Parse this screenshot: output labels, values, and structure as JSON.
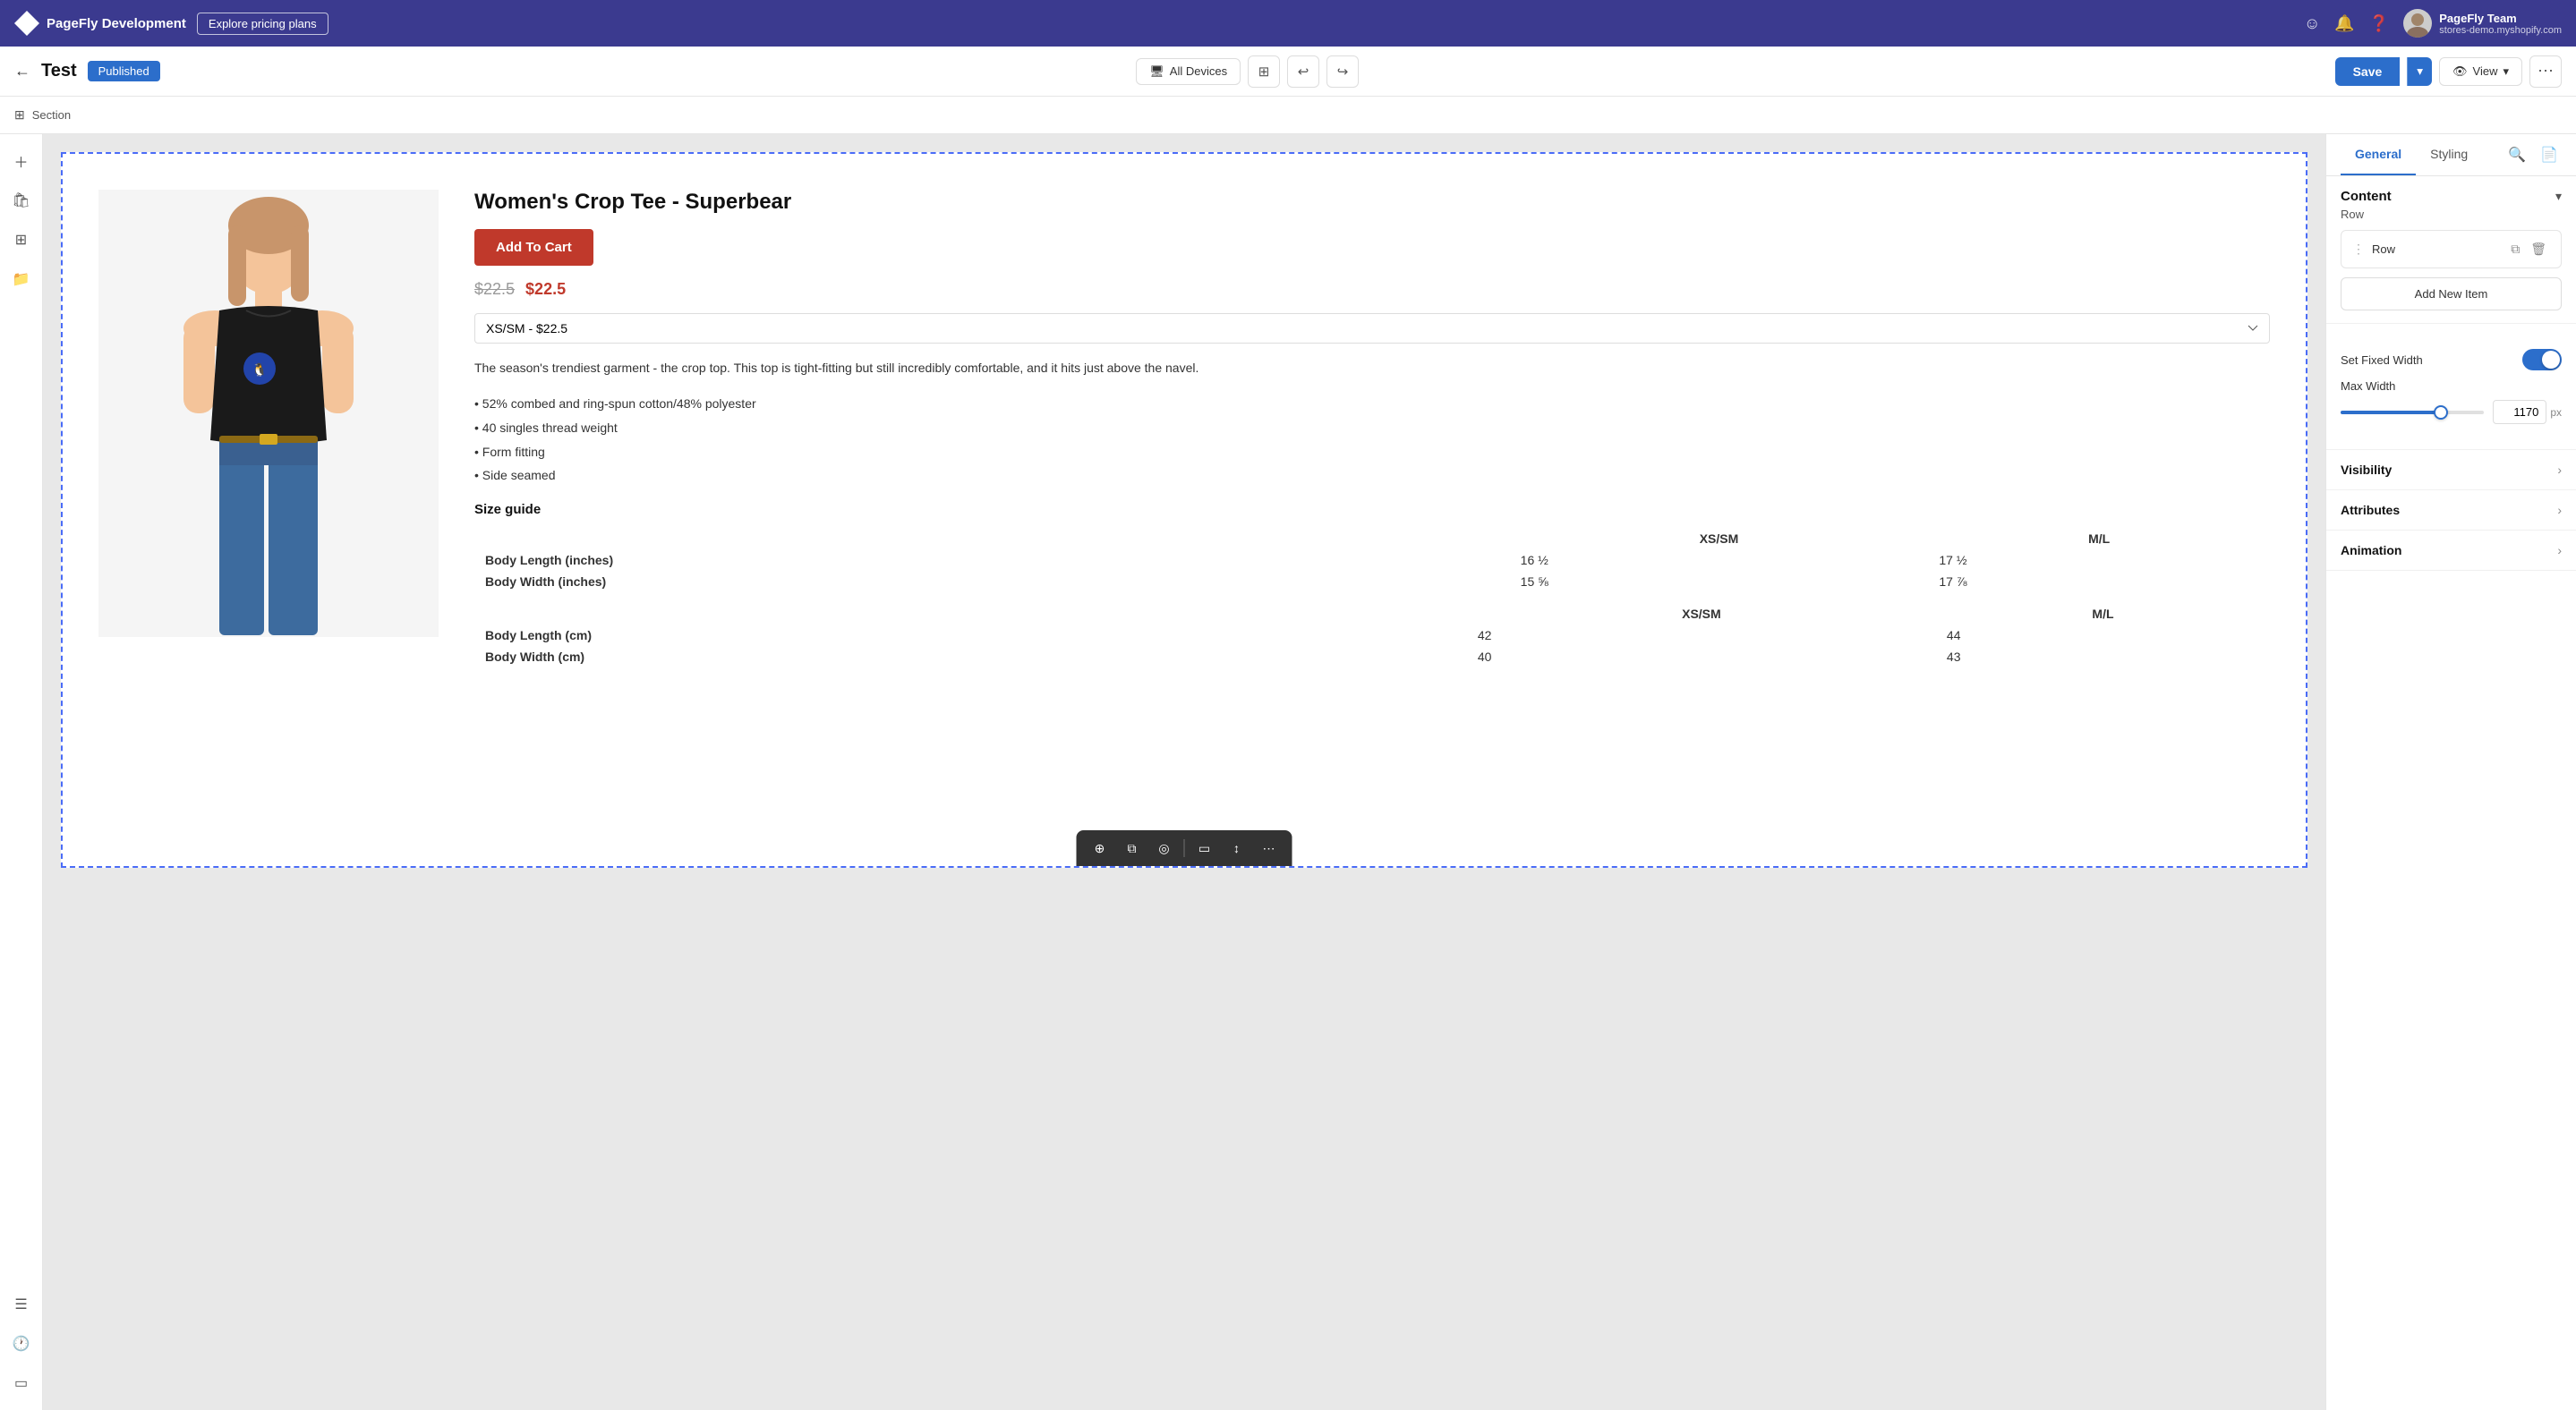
{
  "topNav": {
    "brand": "PageFly",
    "environment": "Development",
    "explorePricing": "Explore pricing plans",
    "user": {
      "name": "PageFly Team",
      "domain": "stores-demo.myshopify.com"
    }
  },
  "editorToolbar": {
    "back_label": "←",
    "pageTitle": "Test",
    "publishedLabel": "Published",
    "deviceLabel": "All Devices",
    "saveLabel": "Save",
    "viewLabel": "View"
  },
  "breadcrumb": {
    "sectionLabel": "Section"
  },
  "product": {
    "title": "Women's Crop Tee - Superbear",
    "addToCartLabel": "Add To Cart",
    "priceOriginal": "$22.5",
    "priceCurrent": "$22.5",
    "variantLabel": "XS/SM - $22.5",
    "description": "The season's trendiest garment - the crop top. This top is tight-fitting but still incredibly comfortable, and it hits just above the navel.",
    "features": "• 52% combed and ring-spun cotton/48% polyester\n• 40 singles thread weight\n• Form fitting\n• Side seamed",
    "sizeGuideLabel": "Size guide",
    "sizeHeaders": [
      "",
      "XS/SM",
      "M/L"
    ],
    "sizeHeadersCm": [
      "",
      "XS/SM",
      "M/L"
    ],
    "sizeRows": [
      [
        "Body Length (inches)",
        "16 ½",
        "17 ½"
      ],
      [
        "Body Width (inches)",
        "15 ⅝",
        "17 ⅞"
      ]
    ],
    "sizeRowsCm": [
      [
        "Body Length (cm)",
        "42",
        "44"
      ],
      [
        "Body Width (cm)",
        "40",
        "43"
      ]
    ]
  },
  "rightPanel": {
    "tabs": [
      {
        "label": "General",
        "active": true
      },
      {
        "label": "Styling",
        "active": false
      }
    ],
    "content": {
      "sectionTitle": "Content",
      "rowLabel": "Row",
      "rowItemLabel": "Row",
      "addNewItemLabel": "Add New Item",
      "setFixedWidthLabel": "Set Fixed Width",
      "maxWidthLabel": "Max Width",
      "maxWidthValue": "1170",
      "maxWidthUnit": "px",
      "sliderPercent": 70
    },
    "visibility": {
      "label": "Visibility"
    },
    "attributes": {
      "label": "Attributes"
    },
    "animation": {
      "label": "Animation"
    }
  },
  "bottomToolbar": {
    "icons": [
      "⊕",
      "⧉",
      "◎",
      "▭",
      "↕",
      "⋯"
    ]
  }
}
